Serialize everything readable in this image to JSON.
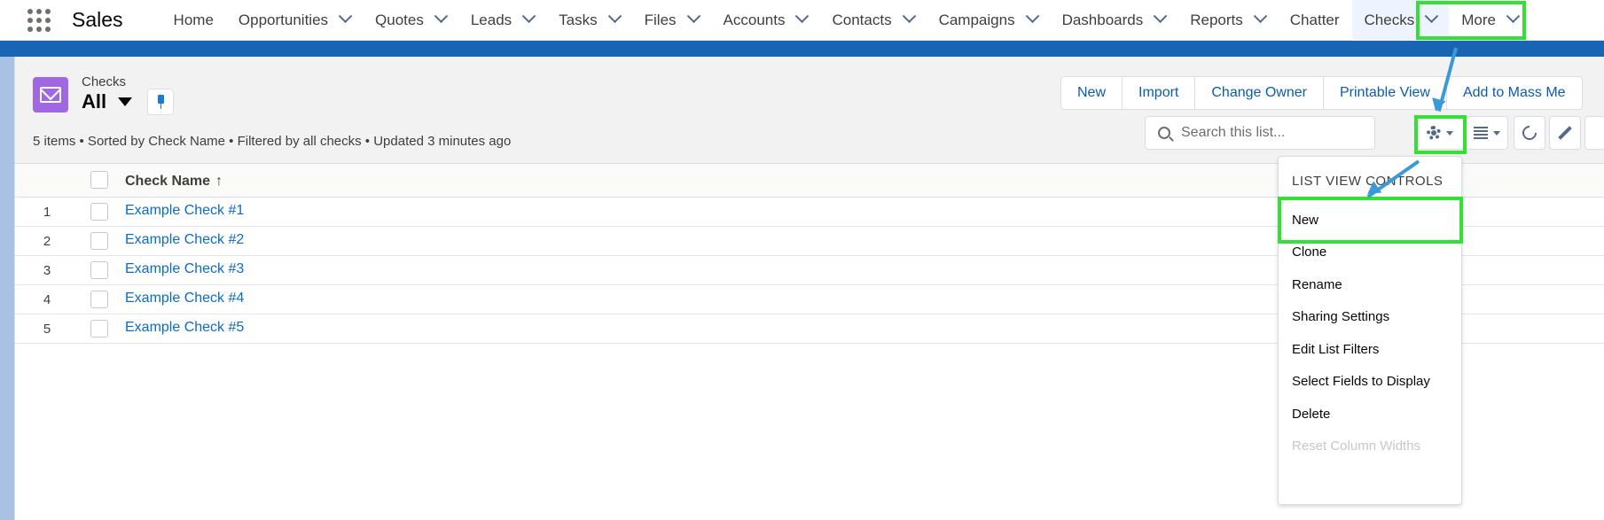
{
  "nav": {
    "app_name": "Sales",
    "items": [
      {
        "label": "Home",
        "has_menu": false
      },
      {
        "label": "Opportunities",
        "has_menu": true
      },
      {
        "label": "Quotes",
        "has_menu": true
      },
      {
        "label": "Leads",
        "has_menu": true
      },
      {
        "label": "Tasks",
        "has_menu": true
      },
      {
        "label": "Files",
        "has_menu": true
      },
      {
        "label": "Accounts",
        "has_menu": true
      },
      {
        "label": "Contacts",
        "has_menu": true
      },
      {
        "label": "Campaigns",
        "has_menu": true
      },
      {
        "label": "Dashboards",
        "has_menu": true
      },
      {
        "label": "Reports",
        "has_menu": true
      },
      {
        "label": "Chatter",
        "has_menu": false
      },
      {
        "label": "Checks",
        "has_menu": true,
        "active": true
      },
      {
        "label": "More",
        "has_menu": true
      }
    ]
  },
  "header": {
    "object_label": "Checks",
    "list_view": "All",
    "summary": "5 items • Sorted by Check Name • Filtered by all checks • Updated 3 minutes ago",
    "buttons": [
      "New",
      "Import",
      "Change Owner",
      "Printable View",
      "Add to Mass Me"
    ],
    "search_placeholder": "Search this list..."
  },
  "table": {
    "column_header": "Check Name",
    "sort_indicator": "↑",
    "rows": [
      {
        "num": "1",
        "name": "Example Check #1"
      },
      {
        "num": "2",
        "name": "Example Check #2"
      },
      {
        "num": "3",
        "name": "Example Check #3"
      },
      {
        "num": "4",
        "name": "Example Check #4"
      },
      {
        "num": "5",
        "name": "Example Check #5"
      }
    ]
  },
  "menu": {
    "title": "LIST VIEW CONTROLS",
    "items": [
      {
        "label": "New",
        "disabled": false
      },
      {
        "label": "Clone",
        "disabled": false
      },
      {
        "label": "Rename",
        "disabled": false
      },
      {
        "label": "Sharing Settings",
        "disabled": false
      },
      {
        "label": "Edit List Filters",
        "disabled": false
      },
      {
        "label": "Select Fields to Display",
        "disabled": false
      },
      {
        "label": "Delete",
        "disabled": false
      },
      {
        "label": "Reset Column Widths",
        "disabled": true
      }
    ]
  },
  "colors": {
    "brand_band": "#1a64b4",
    "object_icon": "#a067e3",
    "link": "#0b6bc8",
    "highlight": "#33e033",
    "annotation_arrow": "#3a9ad9"
  },
  "icons": [
    "app-launcher-icon",
    "email-object-icon",
    "pin-icon",
    "search-icon",
    "gear-icon",
    "table-view-icon",
    "refresh-icon",
    "edit-icon",
    "sort-up-icon",
    "chevron-down-icon"
  ]
}
